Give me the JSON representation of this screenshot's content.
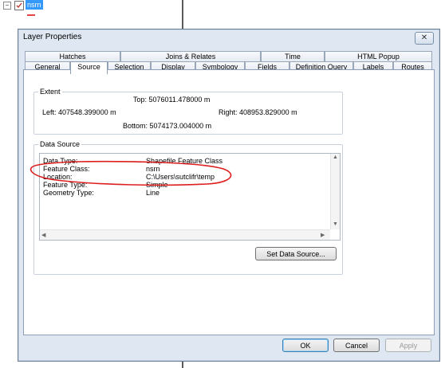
{
  "tree": {
    "layer_name": "nsrn"
  },
  "dialog": {
    "title": "Layer Properties",
    "close_glyph": "✕",
    "tabs_row1": [
      "Hatches",
      "Joins & Relates",
      "Time",
      "HTML Popup"
    ],
    "tabs_row2": [
      "General",
      "Source",
      "Selection",
      "Display",
      "Symbology",
      "Fields",
      "Definition Query",
      "Labels",
      "Routes"
    ],
    "active_tab": "Source",
    "extent": {
      "title": "Extent",
      "top": "Top:  5076011.478000 m",
      "left": "Left:  407548.399000 m",
      "right": "Right:  408953.829000 m",
      "bottom": "Bottom:  5074173.004000 m"
    },
    "data_source": {
      "title": "Data Source",
      "rows": [
        {
          "label": "Data Type:",
          "value": "Shapefile Feature Class"
        },
        {
          "label": "Feature Class:",
          "value": "nsrn"
        },
        {
          "label": "Location:",
          "value": "C:\\Users\\sutclifr\\temp"
        },
        {
          "label": "Feature Type:",
          "value": "Simple"
        },
        {
          "label": "Geometry Type:",
          "value": "Line"
        }
      ],
      "set_button": "Set Data Source..."
    },
    "buttons": {
      "ok": "OK",
      "cancel": "Cancel",
      "apply": "Apply"
    }
  },
  "colors": {
    "annotation": "#dd1f1f",
    "selection": "#3399ff"
  },
  "icons": {
    "tree_toggle": "minus-box-icon",
    "layer_check": "checkbox-icon"
  }
}
